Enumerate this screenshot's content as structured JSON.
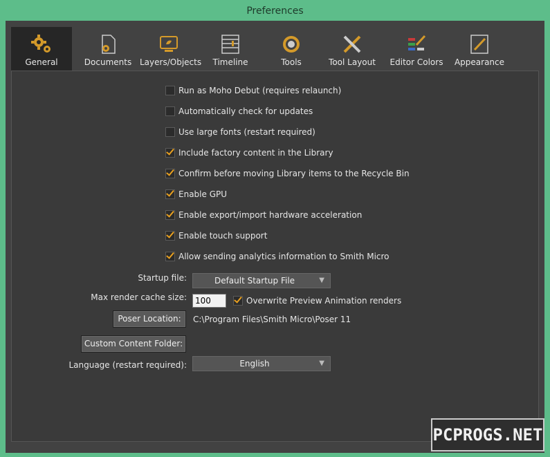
{
  "window": {
    "title": "Preferences"
  },
  "tabs": [
    {
      "label": "General",
      "icon": "gears-icon",
      "active": true
    },
    {
      "label": "Documents",
      "icon": "document-gear-icon",
      "active": false
    },
    {
      "label": "Layers/Objects",
      "icon": "layers-icon",
      "active": false
    },
    {
      "label": "Timeline",
      "icon": "timeline-icon",
      "active": false
    },
    {
      "label": "Tools",
      "icon": "tools-icon",
      "active": false
    },
    {
      "label": "Tool Layout",
      "icon": "tool-layout-icon",
      "active": false
    },
    {
      "label": "Editor Colors",
      "icon": "editor-colors-icon",
      "active": false
    },
    {
      "label": "Appearance",
      "icon": "appearance-icon",
      "active": false
    }
  ],
  "options": [
    {
      "label": "Run as Moho Debut (requires relaunch)",
      "checked": false
    },
    {
      "label": "Automatically check for updates",
      "checked": false
    },
    {
      "label": "Use large fonts (restart required)",
      "checked": false
    },
    {
      "label": "Include factory content in the Library",
      "checked": true
    },
    {
      "label": "Confirm before moving Library items to the Recycle Bin",
      "checked": true
    },
    {
      "label": "Enable GPU",
      "checked": true
    },
    {
      "label": "Enable export/import hardware acceleration",
      "checked": true
    },
    {
      "label": "Enable touch support",
      "checked": true
    },
    {
      "label": "Allow sending analytics information to Smith Micro",
      "checked": true
    }
  ],
  "startup": {
    "label": "Startup file:",
    "value": "Default Startup File"
  },
  "cache": {
    "label": "Max render cache size:",
    "value": "100",
    "overwrite_label": "Overwrite Preview Animation renders",
    "overwrite_checked": true
  },
  "poser": {
    "button": "Poser Location:",
    "path": "C:\\Program Files\\Smith Micro\\Poser 11"
  },
  "custom_content": {
    "button": "Custom Content Folder:"
  },
  "language": {
    "label": "Language (restart required):",
    "value": "English"
  },
  "watermark": "PCPROGS.NET",
  "colors": {
    "accent": "#e8a020",
    "frame": "#5dbd8a",
    "panel": "#424242"
  }
}
